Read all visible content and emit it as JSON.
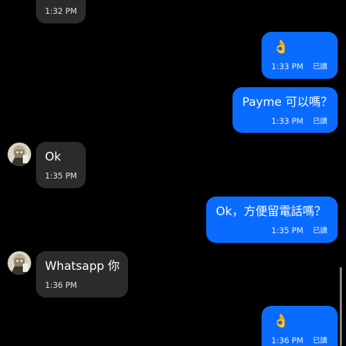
{
  "messages": [
    {
      "direction": "incoming",
      "time": "1:32 PM"
    },
    {
      "direction": "outgoing",
      "text": "👌",
      "time": "1:33 PM",
      "status": "已讀"
    },
    {
      "direction": "outgoing",
      "text": "Payme 可以嗎？",
      "time": "1:33 PM",
      "status": "已讀"
    },
    {
      "direction": "incoming",
      "text": "Ok",
      "time": "1:35 PM"
    },
    {
      "direction": "outgoing",
      "text": "Ok，方便留電話嗎？",
      "time": "1:35 PM",
      "status": "已讀"
    },
    {
      "direction": "incoming",
      "text": "Whatsapp 你",
      "time": "1:36 PM"
    },
    {
      "direction": "outgoing",
      "text": "👌",
      "time": "1:36 PM",
      "status": "已讀"
    }
  ],
  "colors": {
    "background": "#000000",
    "incoming_bubble": "#2b2b2d",
    "outgoing_bubble": "#0a6cff",
    "text": "#ffffff"
  }
}
